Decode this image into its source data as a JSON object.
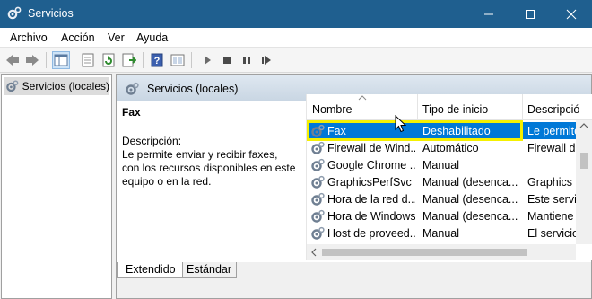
{
  "window": {
    "title": "Servicios",
    "controls": {
      "minimize": "minimize-icon",
      "maximize": "maximize-icon",
      "close": "close-icon"
    }
  },
  "menu": {
    "items": [
      {
        "accel": "",
        "rest": "rchivo",
        "first": "A"
      },
      {
        "accel": "A",
        "rest": "cción",
        "first": ""
      },
      {
        "accel": "V",
        "rest": "er",
        "first": ""
      },
      {
        "accel": "A",
        "rest": "yuda",
        "first": ""
      }
    ],
    "labels": [
      "Archivo",
      "Acción",
      "Ver",
      "Ayuda"
    ]
  },
  "toolbar": {
    "icons": [
      "back-arrow-icon",
      "forward-arrow-icon",
      "show-hide-tree-icon",
      "properties-icon",
      "refresh-icon",
      "export-list-icon",
      "help-icon",
      "console-icon",
      "start-service-icon",
      "stop-service-icon",
      "pause-service-icon",
      "restart-service-icon"
    ]
  },
  "tree": {
    "item_label": "Servicios (locales)"
  },
  "panel": {
    "header": "Servicios (locales)",
    "service_name": "Fax",
    "description_label": "Descripción:",
    "description_text": "Le permite enviar y recibir faxes, con los recursos disponibles en este equipo o en la red."
  },
  "list": {
    "columns": [
      "Nombre",
      "Tipo de inicio",
      "Descripció"
    ],
    "rows": [
      {
        "name": "Fax",
        "startup": "Deshabilitado",
        "desc": "Le permite",
        "selected": true
      },
      {
        "name": "Firewall de Wind...",
        "startup": "Automático",
        "desc": "Firewall de"
      },
      {
        "name": "Google Chrome ...",
        "startup": "Manual",
        "desc": ""
      },
      {
        "name": "GraphicsPerfSvc",
        "startup": "Manual (desenca...",
        "desc": "Graphics p"
      },
      {
        "name": "Hora de la red d...",
        "startup": "Manual (desenca...",
        "desc": "Este servic"
      },
      {
        "name": "Hora de Windows",
        "startup": "Manual (desenca...",
        "desc": "Mantiene"
      },
      {
        "name": "Host de proveed...",
        "startup": "Manual",
        "desc": "El servicio"
      }
    ]
  },
  "tabs": {
    "extended": "Extendido",
    "standard": "Estándar"
  },
  "colors": {
    "titlebar": "#1f5f8f",
    "selection": "#0078d7",
    "highlight": "#f5f000"
  }
}
